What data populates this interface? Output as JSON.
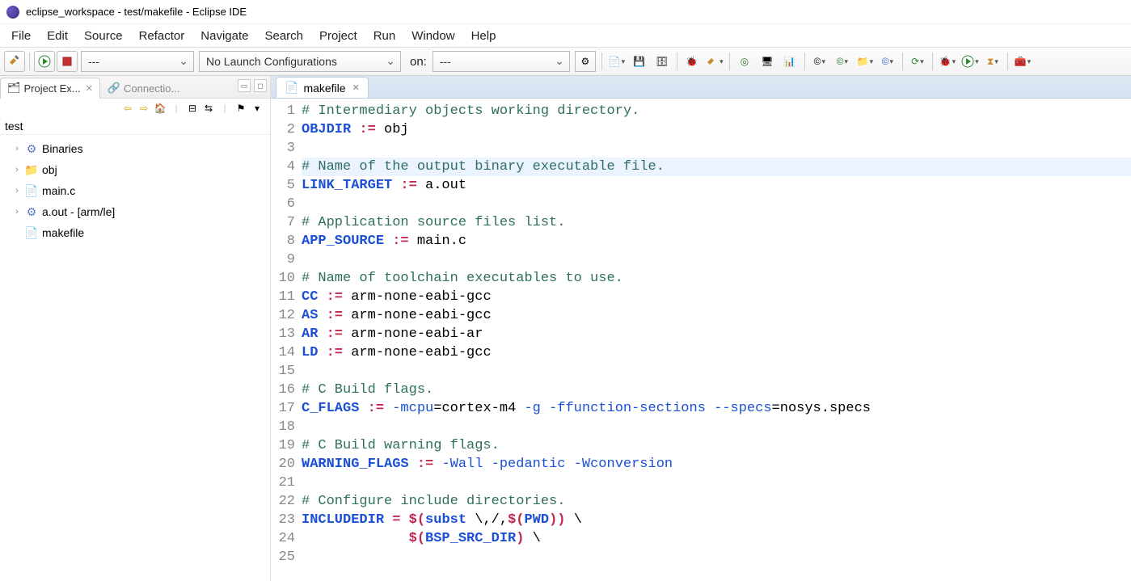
{
  "window": {
    "title": "eclipse_workspace - test/makefile - Eclipse IDE"
  },
  "menu": {
    "items": [
      "File",
      "Edit",
      "Source",
      "Refactor",
      "Navigate",
      "Search",
      "Project",
      "Run",
      "Window",
      "Help"
    ]
  },
  "toolbar": {
    "combo1": "---",
    "combo2": "No Launch Configurations",
    "on_label": "on:",
    "combo3": "---"
  },
  "left": {
    "tab1": "Project Ex...",
    "tab2": "Connectio...",
    "root": "test",
    "items": [
      {
        "label": "Binaries",
        "icon": "binaries-icon",
        "expandable": true
      },
      {
        "label": "obj",
        "icon": "folder-icon",
        "expandable": true
      },
      {
        "label": "main.c",
        "icon": "cfile-icon",
        "expandable": true
      },
      {
        "label": "a.out - [arm/le]",
        "icon": "binary-icon",
        "expandable": true
      },
      {
        "label": "makefile",
        "icon": "makefile-icon",
        "expandable": false
      }
    ]
  },
  "editor": {
    "tab": "makefile",
    "lines": [
      {
        "n": 1,
        "t": "comment",
        "text": "# Intermediary objects working directory."
      },
      {
        "n": 2,
        "t": "assign",
        "var": "OBJDIR",
        "op": ":=",
        "val": " obj"
      },
      {
        "n": 3,
        "t": "blank",
        "text": ""
      },
      {
        "n": 4,
        "t": "comment",
        "text": "# Name of the output binary executable file.",
        "hl": true
      },
      {
        "n": 5,
        "t": "assign",
        "var": "LINK_TARGET",
        "op": ":=",
        "val": " a.out"
      },
      {
        "n": 6,
        "t": "blank",
        "text": ""
      },
      {
        "n": 7,
        "t": "comment",
        "text": "# Application source files list."
      },
      {
        "n": 8,
        "t": "assign",
        "var": "APP_SOURCE",
        "op": ":=",
        "val": " main.c"
      },
      {
        "n": 9,
        "t": "blank",
        "text": ""
      },
      {
        "n": 10,
        "t": "comment",
        "text": "# Name of toolchain executables to use."
      },
      {
        "n": 11,
        "t": "assign",
        "var": "CC",
        "op": ":=",
        "val": " arm-none-eabi-gcc"
      },
      {
        "n": 12,
        "t": "assign",
        "var": "AS",
        "op": ":=",
        "val": " arm-none-eabi-gcc"
      },
      {
        "n": 13,
        "t": "assign",
        "var": "AR",
        "op": ":=",
        "val": " arm-none-eabi-ar"
      },
      {
        "n": 14,
        "t": "assign",
        "var": "LD",
        "op": ":=",
        "val": " arm-none-eabi-gcc"
      },
      {
        "n": 15,
        "t": "blank",
        "text": ""
      },
      {
        "n": 16,
        "t": "comment",
        "text": "# C Build flags."
      },
      {
        "n": 17,
        "t": "cflags",
        "var": "C_FLAGS",
        "op": ":=",
        "segs": [
          {
            "k": "plain",
            "v": " "
          },
          {
            "k": "flag",
            "v": "-mcpu"
          },
          {
            "k": "plain",
            "v": "=cortex-m4 "
          },
          {
            "k": "flag",
            "v": "-g"
          },
          {
            "k": "plain",
            "v": " "
          },
          {
            "k": "flag",
            "v": "-ffunction-sections"
          },
          {
            "k": "plain",
            "v": " "
          },
          {
            "k": "flag",
            "v": "--specs"
          },
          {
            "k": "plain",
            "v": "=nosys.specs"
          }
        ]
      },
      {
        "n": 18,
        "t": "blank",
        "text": ""
      },
      {
        "n": 19,
        "t": "comment",
        "text": "# C Build warning flags."
      },
      {
        "n": 20,
        "t": "cflags",
        "var": "WARNING_FLAGS",
        "op": ":=",
        "segs": [
          {
            "k": "plain",
            "v": " "
          },
          {
            "k": "flag",
            "v": "-Wall"
          },
          {
            "k": "plain",
            "v": " "
          },
          {
            "k": "flag",
            "v": "-pedantic"
          },
          {
            "k": "plain",
            "v": " "
          },
          {
            "k": "flag",
            "v": "-Wconversion"
          }
        ]
      },
      {
        "n": 21,
        "t": "blank",
        "text": ""
      },
      {
        "n": 22,
        "t": "comment",
        "text": "# Configure include directories."
      },
      {
        "n": 23,
        "t": "incdir",
        "var": "INCLUDEDIR",
        "op": "=",
        "fn": "subst",
        "args": "\\,/,",
        "argvar": "PWD",
        "tail": " \\"
      },
      {
        "n": 24,
        "t": "incvar",
        "indent": "             ",
        "argvar": "BSP_SRC_DIR",
        "tail": " \\"
      },
      {
        "n": 25,
        "t": "blank",
        "text": ""
      }
    ]
  }
}
